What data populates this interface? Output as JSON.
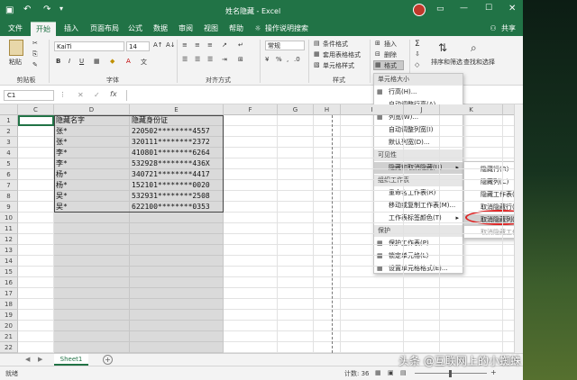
{
  "title": "姓名隐藏 - Excel",
  "quick_access": {
    "save_icon": "save-icon",
    "undo_icon": "undo-icon",
    "redo_icon": "redo-icon"
  },
  "tabs": [
    "文件",
    "开始",
    "插入",
    "页面布局",
    "公式",
    "数据",
    "审阅",
    "视图",
    "帮助"
  ],
  "tell_me": "操作说明搜索",
  "share": "共享",
  "ribbon": {
    "paste": "粘贴",
    "font_name": "KaiTi",
    "font_size": "14",
    "number_format": "常规",
    "conditional_format": "条件格式",
    "table_format": "套用表格格式",
    "cell_styles": "单元格样式",
    "insert": "插入",
    "delete": "删除",
    "format": "格式",
    "sort_filter": "排序和筛选",
    "find_select": "查找和选择",
    "groups": [
      "剪贴板",
      "字体",
      "对齐方式",
      "样式"
    ]
  },
  "name_box": "C1",
  "columns": [
    "C",
    "D",
    "E",
    "F",
    "G",
    "H",
    "I",
    "J",
    "K",
    "L",
    "M"
  ],
  "rows": [
    "1",
    "2",
    "3",
    "4",
    "5",
    "6",
    "7",
    "8",
    "9",
    "10",
    "11",
    "12",
    "13",
    "14",
    "15",
    "16",
    "17",
    "18",
    "19",
    "20",
    "21",
    "22"
  ],
  "table": {
    "headers": [
      "隐藏名字",
      "隐藏身份证"
    ],
    "data": [
      [
        "张*",
        "220502********4557"
      ],
      [
        "张*",
        "320111********2372"
      ],
      [
        "李*",
        "410801********6264"
      ],
      [
        "李*",
        "532928********436X"
      ],
      [
        "杨*",
        "340721********4417"
      ],
      [
        "杨*",
        "152101********0020"
      ],
      [
        "吴*",
        "532931********2508"
      ],
      [
        "吴*",
        "622100********0353"
      ]
    ]
  },
  "format_menu": {
    "sections": [
      {
        "header": "单元格大小",
        "items": [
          {
            "label": "行高(H)...",
            "icon": "row-height-icon"
          },
          {
            "label": "自动调整行高(A)",
            "icon": ""
          },
          {
            "label": "列宽(W)...",
            "icon": "column-width-icon"
          },
          {
            "label": "自动调整列宽(I)",
            "icon": ""
          },
          {
            "label": "默认列宽(D)...",
            "icon": ""
          }
        ]
      },
      {
        "header": "可见性",
        "items": [
          {
            "label": "隐藏和取消隐藏(U)",
            "icon": "",
            "submenu": true,
            "highlight": true
          }
        ]
      },
      {
        "header": "组织工作表",
        "items": [
          {
            "label": "重命名工作表(R)",
            "icon": ""
          },
          {
            "label": "移动或复制工作表(M)...",
            "icon": ""
          },
          {
            "label": "工作表标签颜色(T)",
            "icon": "",
            "submenu": true
          }
        ]
      },
      {
        "header": "保护",
        "items": [
          {
            "label": "保护工作表(P)...",
            "icon": "protect-sheet-icon"
          },
          {
            "label": "锁定单元格(L)",
            "icon": "lock-cell-icon"
          },
          {
            "label": "设置单元格格式(E)...",
            "icon": "format-cells-icon"
          }
        ]
      }
    ]
  },
  "submenu": [
    {
      "label": "隐藏行(R)",
      "disabled": false
    },
    {
      "label": "隐藏列(C)",
      "disabled": false
    },
    {
      "label": "隐藏工作表(S)",
      "disabled": false
    },
    {
      "label": "取消隐藏行(O)",
      "disabled": false
    },
    {
      "label": "取消隐藏列(L)",
      "disabled": false,
      "highlight": true
    },
    {
      "label": "取消隐藏工作表(H)...",
      "disabled": true
    }
  ],
  "sheet_tab": "Sheet1",
  "status": {
    "ready": "就绪",
    "count": "计数: 36",
    "zoom": "+"
  },
  "watermark": "头条 @互联网上的小蜘蛛"
}
